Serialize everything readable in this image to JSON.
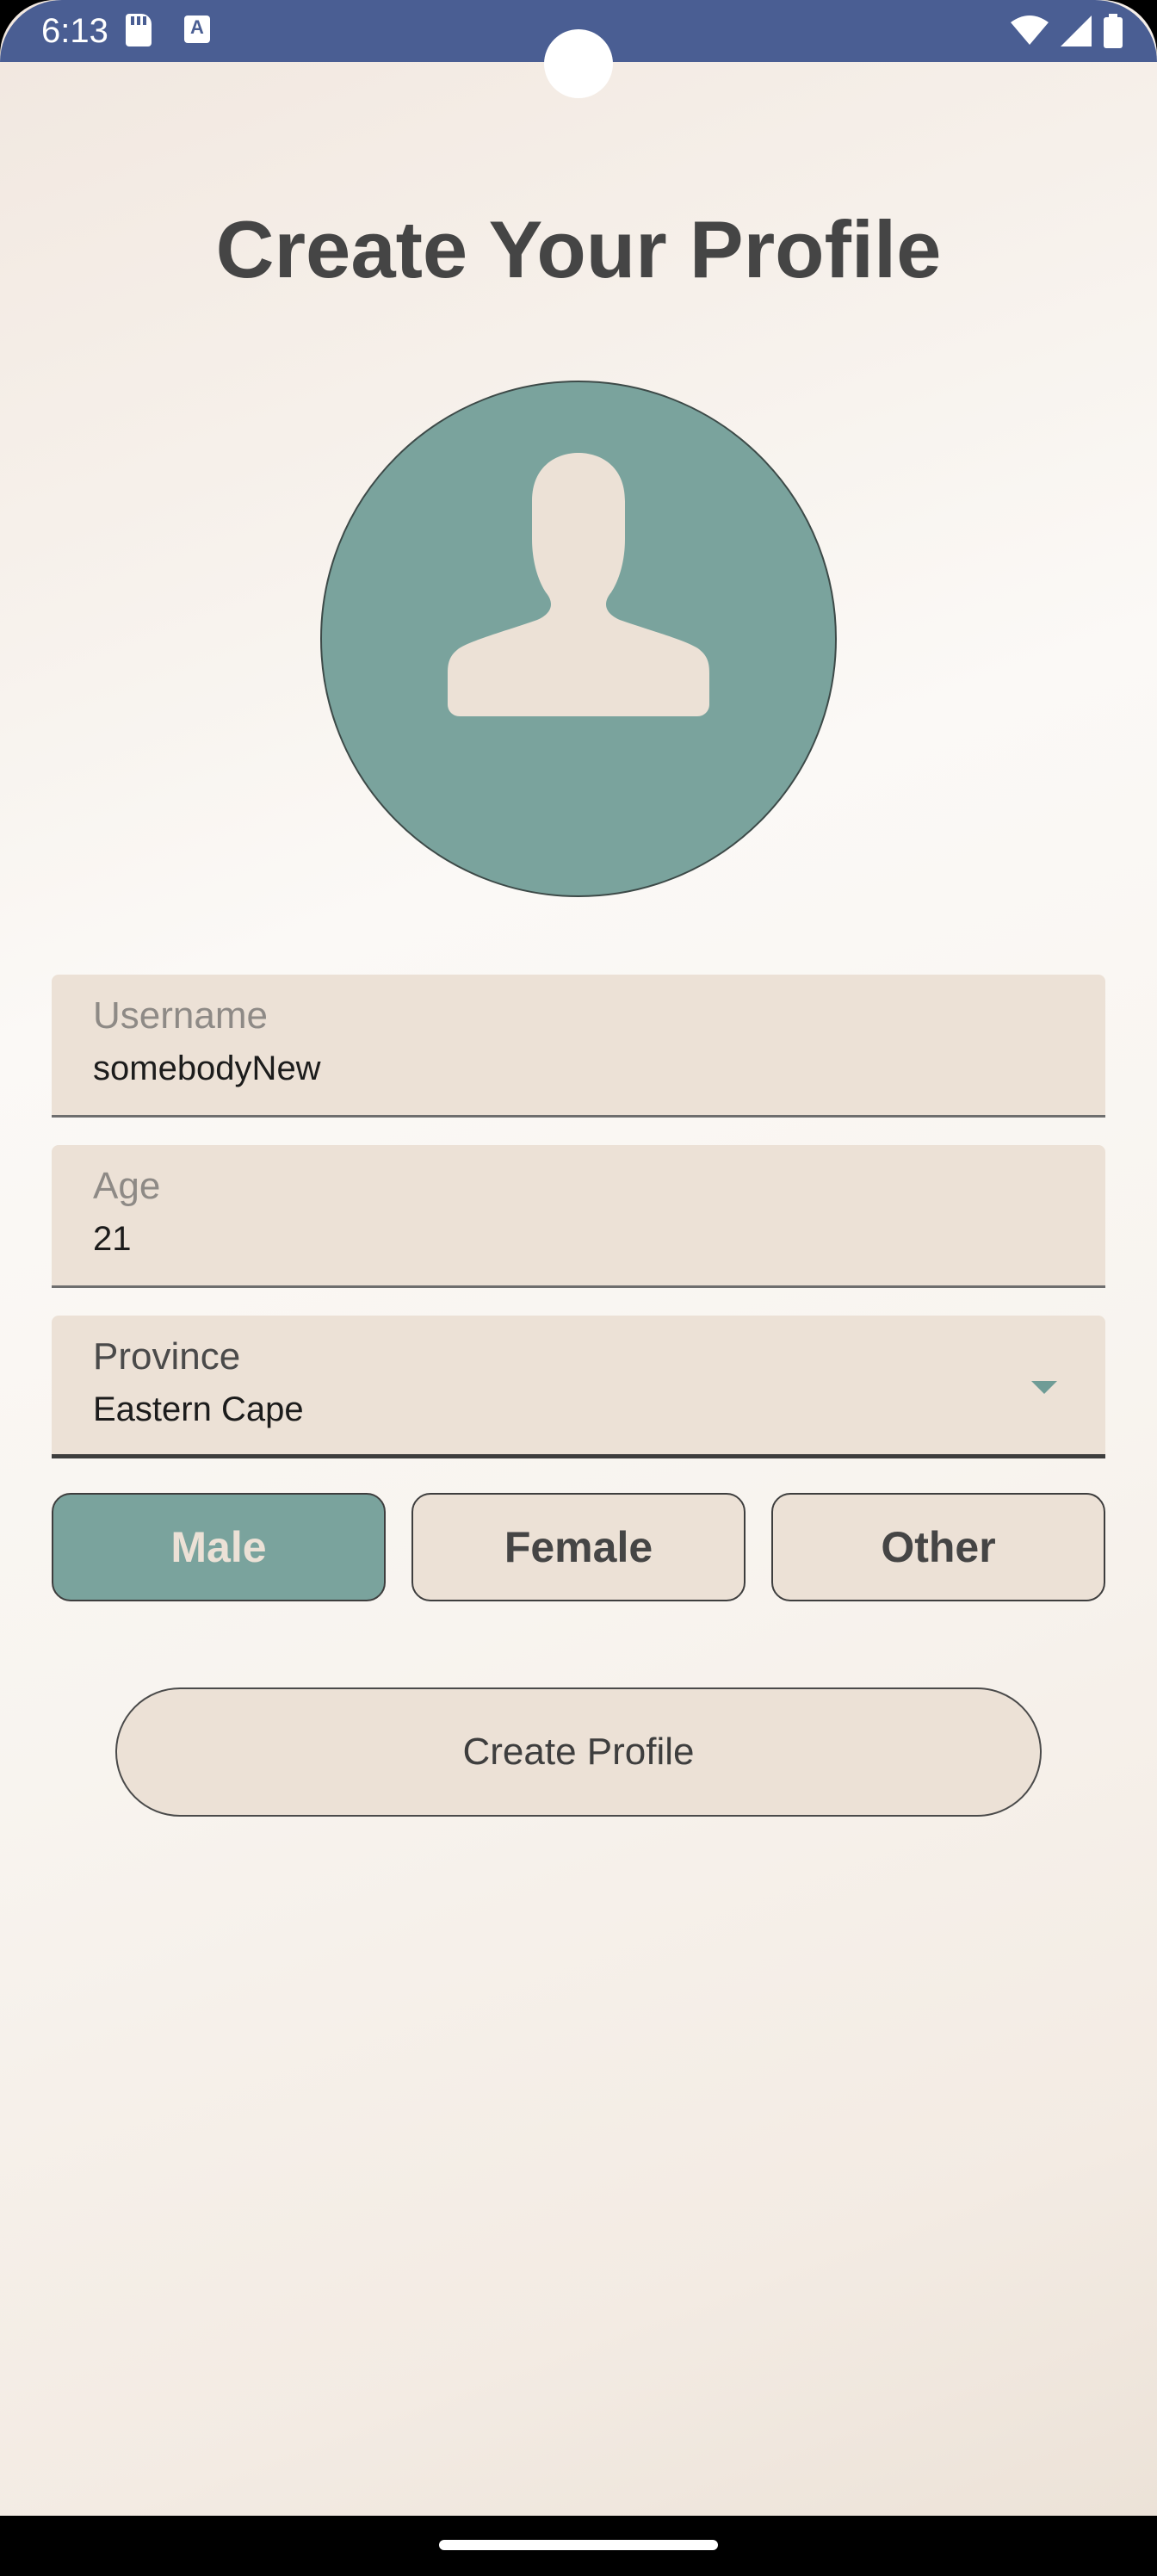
{
  "status_bar": {
    "time": "6:13",
    "background": "#4a5e93",
    "icons": [
      "sd-card-icon",
      "keyboard-a-icon",
      "wifi-icon",
      "cellular-signal-icon",
      "battery-icon"
    ]
  },
  "page": {
    "title": "Create Your Profile"
  },
  "avatar": {
    "icon": "person-silhouette-icon",
    "background": "#7aa39d",
    "silhouette_color": "#ece1d6"
  },
  "form": {
    "username": {
      "label": "Username",
      "value": "somebodyNew"
    },
    "age": {
      "label": "Age",
      "value": "21"
    },
    "province": {
      "label": "Province",
      "value": "Eastern Cape",
      "icon": "dropdown-arrow-icon"
    }
  },
  "gender": {
    "options": [
      "Male",
      "Female",
      "Other"
    ],
    "selected": "Male",
    "selected_color": "#7aa39d"
  },
  "actions": {
    "create_label": "Create Profile"
  },
  "colors": {
    "field_background": "#ece1d6",
    "text_dark": "#454545",
    "accent": "#7aa39d"
  }
}
